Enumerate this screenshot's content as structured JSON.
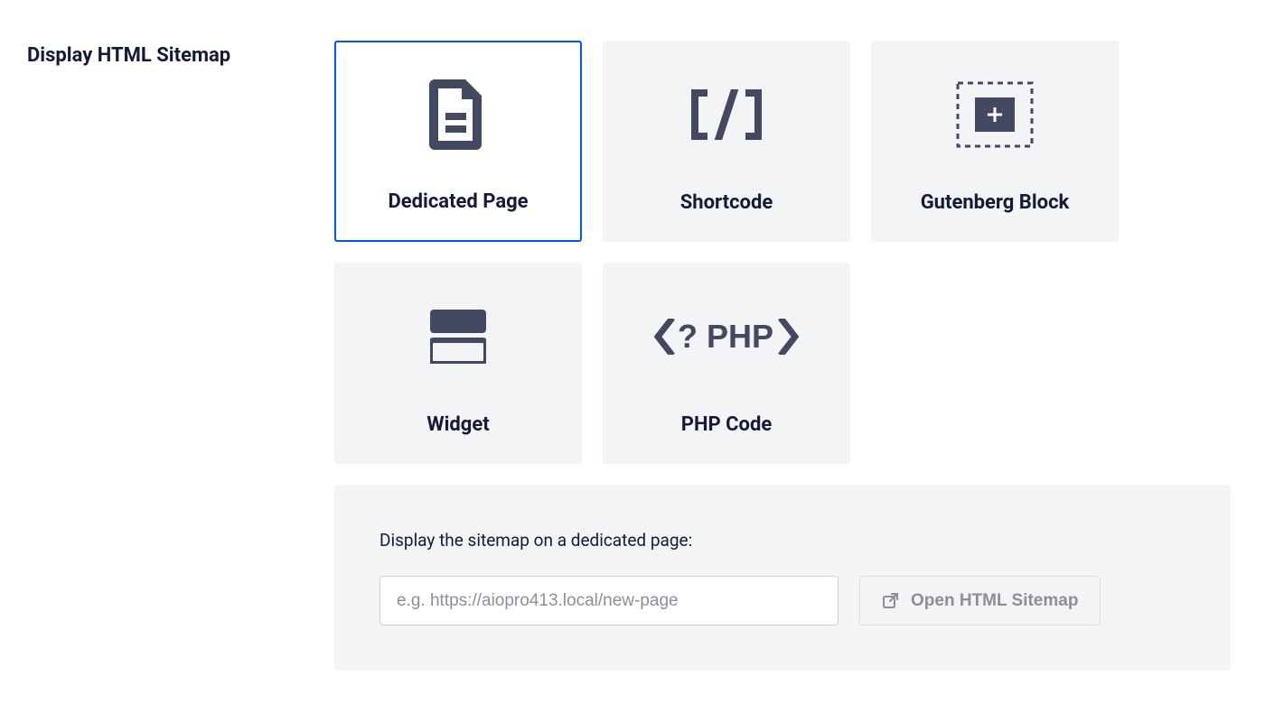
{
  "section": {
    "title": "Display HTML Sitemap"
  },
  "options": [
    {
      "label": "Dedicated Page",
      "selected": true
    },
    {
      "label": "Shortcode",
      "selected": false
    },
    {
      "label": "Gutenberg Block",
      "selected": false
    },
    {
      "label": "Widget",
      "selected": false
    },
    {
      "label": "PHP Code",
      "selected": false
    }
  ],
  "panel": {
    "label": "Display the sitemap on a dedicated page:",
    "url_value": "",
    "url_placeholder": "e.g. https://aiopro413.local/new-page",
    "open_button": "Open HTML Sitemap"
  }
}
